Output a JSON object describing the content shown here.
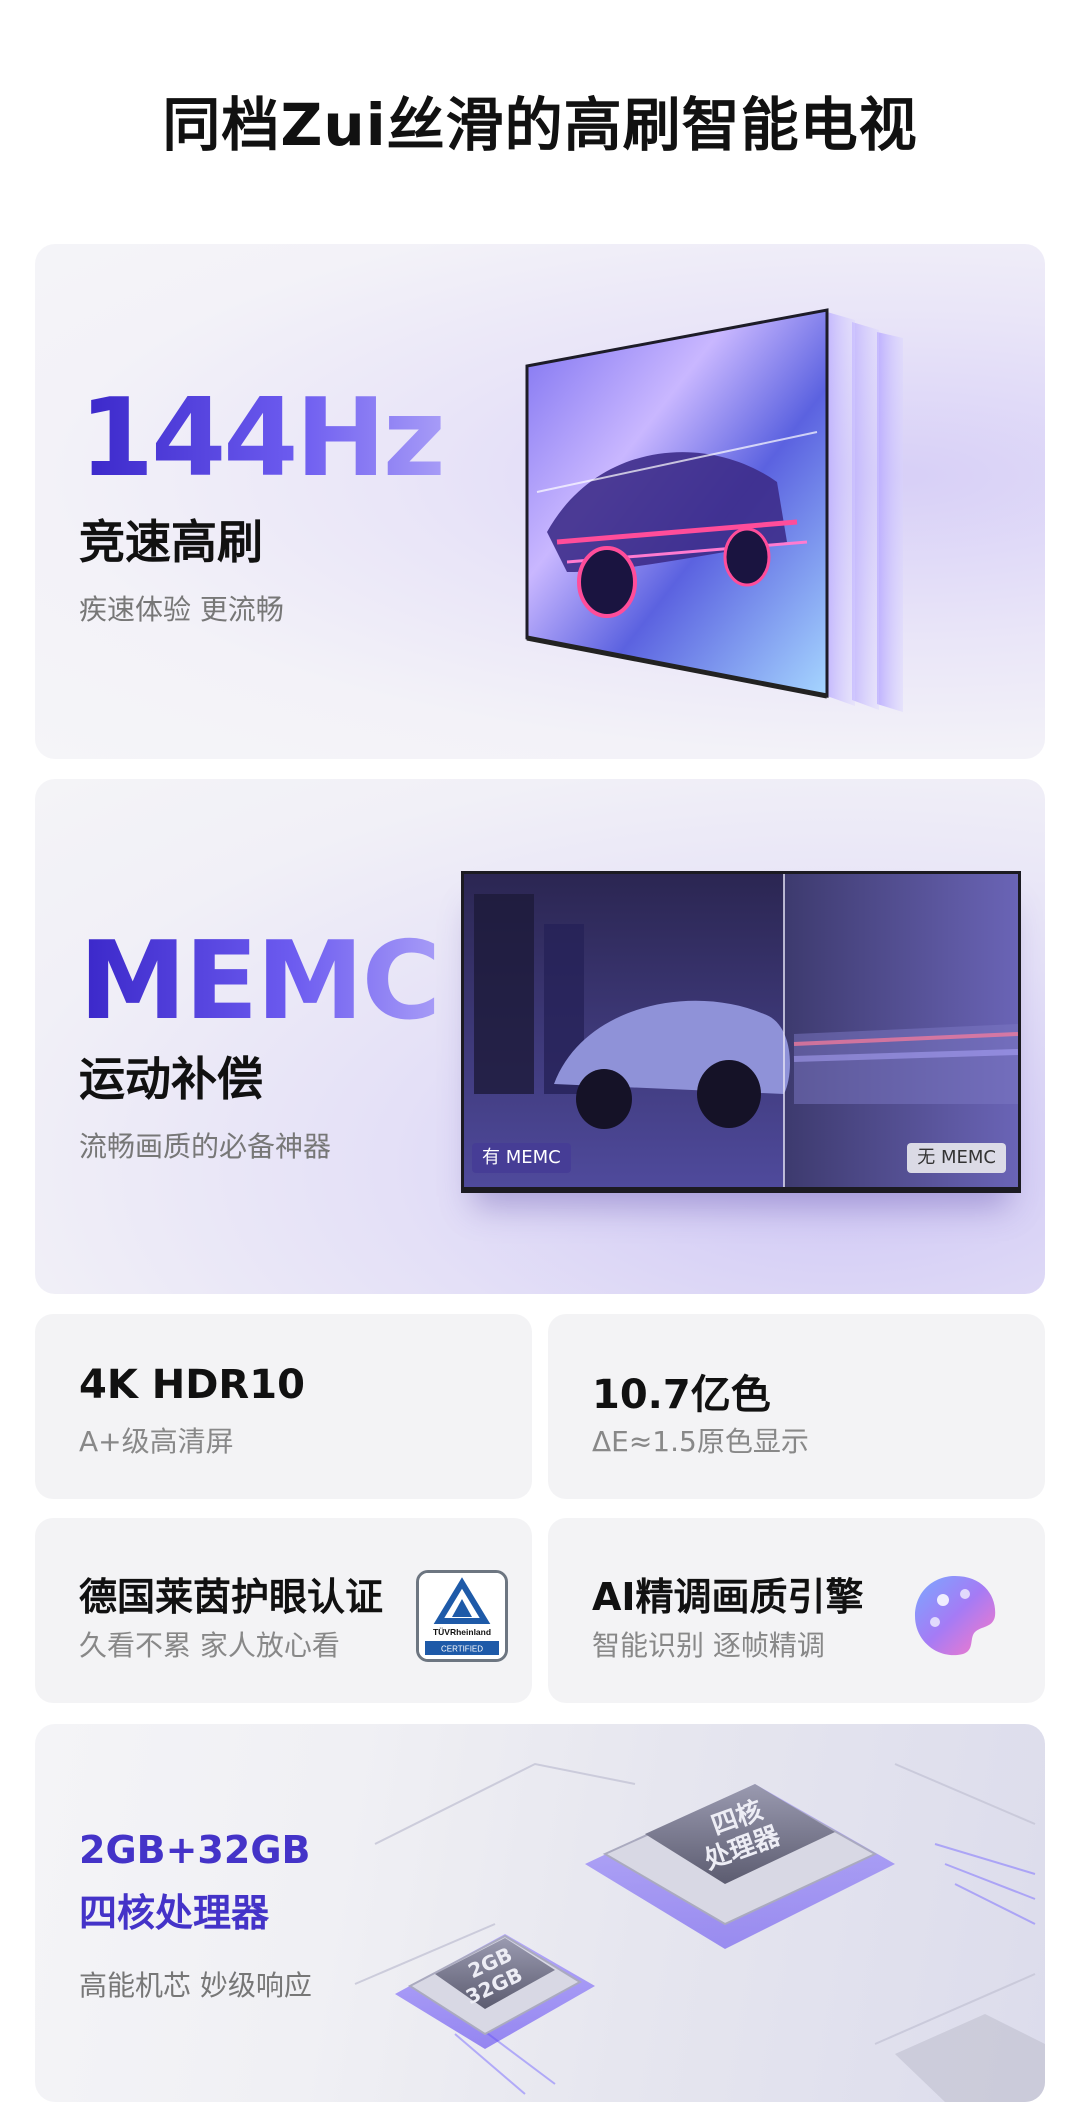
{
  "page": {
    "title": "同档Zui丝滑的高刷智能电视"
  },
  "refresh": {
    "value": "144Hz",
    "heading": "竞速高刷",
    "desc": "疾速体验 更流畅"
  },
  "memc": {
    "value": "MEMC",
    "heading": "运动补偿",
    "desc": "流畅画质的必备神器",
    "tag_on": "有 MEMC",
    "tag_off": "无 MEMC"
  },
  "features": [
    {
      "title": "4K HDR10",
      "sub": "A+级高清屏"
    },
    {
      "title": "10.7亿色",
      "sub": "ΔE≈1.5原色显示"
    },
    {
      "title": "德国莱茵护眼认证",
      "sub": "久看不累 家人放心看",
      "badge": "TÜVRheinland",
      "badge_sub": "CERTIFIED"
    },
    {
      "title": "AI精调画质引擎",
      "sub": "智能识别 逐帧精调",
      "icon": "palette-icon"
    }
  ],
  "processor": {
    "line1": "2GB+32GB",
    "line2": "四核处理器",
    "desc": "高能机芯 妙级响应",
    "chip_big": [
      "四核",
      "处理器"
    ],
    "chip_small": [
      "2GB",
      "32GB"
    ]
  },
  "colors": {
    "accent": "#4433c8",
    "accent_light": "#8b7ff2",
    "card_bg": "#f3f3f5"
  }
}
